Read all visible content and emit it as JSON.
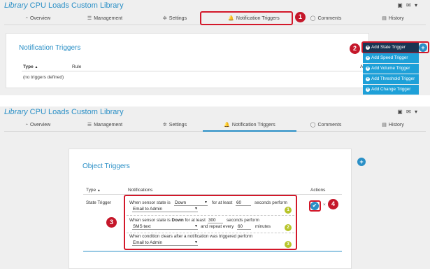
{
  "app": {
    "title_prefix": "Library",
    "title_rest": " CPU Loads Custom Library",
    "tools": [
      "report-icon",
      "mail-icon",
      "caret-icon"
    ],
    "tools_glyphs": [
      "▣",
      "✉",
      "▾"
    ]
  },
  "tabs": [
    {
      "label": "Overview",
      "icon": "gauge-icon",
      "glyph": "◔"
    },
    {
      "label": "Management",
      "icon": "sliders-icon",
      "glyph": "☰"
    },
    {
      "label": "Settings",
      "icon": "gear-icon",
      "glyph": "✲"
    },
    {
      "label": "Notification Triggers",
      "icon": "bell-icon",
      "glyph": "🔔"
    },
    {
      "label": "Comments",
      "icon": "comment-icon",
      "glyph": "◯"
    },
    {
      "label": "History",
      "icon": "history-icon",
      "glyph": "▤"
    }
  ],
  "top": {
    "card_title": "Notification Triggers",
    "col_type": "Type",
    "col_type_sort": "▲",
    "col_rule": "Rule",
    "col_actions_partial": "A",
    "empty": "(no triggers defined)",
    "dropdown": [
      "Add State Trigger",
      "Add Speed Trigger",
      "Add Volume Trigger",
      "Add Threshold Trigger",
      "Add Change Trigger"
    ],
    "plus_glyph": "+"
  },
  "bottom": {
    "card_title": "Object Triggers",
    "col_type": "Type",
    "col_type_sort": "▲",
    "col_notifications": "Notifications",
    "col_actions": "Actions",
    "row_type": "State Trigger",
    "line1": {
      "prefix": "When sensor state is",
      "state": "Down",
      "middle": "for at least",
      "seconds": "60",
      "suffix": "seconds perform",
      "action": "Email to Admin"
    },
    "line2": {
      "prefix": "When sensor state is",
      "state_bold": "Down",
      "middle": "for at least",
      "seconds": "300",
      "suffix": "seconds perform",
      "action": "SMS text",
      "repeat_label": "and repeat every",
      "repeat": "60",
      "repeat_unit": "minutes"
    },
    "line3": {
      "text": "When condition clears after a notification was triggered perform",
      "action": "Email to Admin"
    },
    "check_glyph": "✔",
    "x_glyph": "×",
    "plus_glyph": "+"
  },
  "callouts": {
    "red": [
      "1",
      "2",
      "3",
      "4"
    ],
    "green": [
      "1",
      "2",
      "3"
    ],
    "red_color": "#c5172a",
    "green_color": "#b7c42a"
  },
  "colors": {
    "accent": "#2a8fc6",
    "dropdown": "#1ea0d8",
    "dropdown_active": "#1a3552"
  }
}
